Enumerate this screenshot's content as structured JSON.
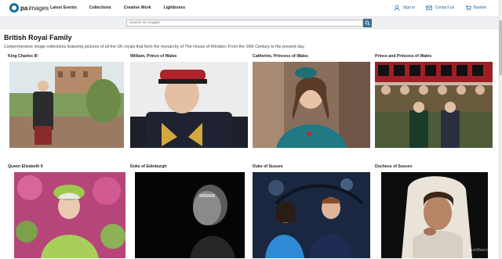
{
  "header": {
    "logo_pa": "pa",
    "logo_images": "images",
    "nav": [
      "Latest Events",
      "Collections",
      "Creative Work",
      "Lightboxes"
    ],
    "sign_in": "Sign in",
    "contact": "Contact us",
    "basket": "Basket"
  },
  "search": {
    "placeholder": "Search for images"
  },
  "page": {
    "title": "British Royal Family",
    "description": "Comprehensive image collections featuring pictures of all the UK royals that form the monarchy of The House of Windsor. From the 19th Century to the present day."
  },
  "collections": [
    {
      "title": "King Charles III"
    },
    {
      "title": "William, Prince of Wales"
    },
    {
      "title": "Catherine, Princess of Wales"
    },
    {
      "title": "Prince and Princess of Wales"
    },
    {
      "title": "Queen Elizabeth II"
    },
    {
      "title": "Duke of Edinburgh"
    },
    {
      "title": "Duke of Sussex"
    },
    {
      "title": "Duchess of Sussex"
    }
  ],
  "watermark": "PeakMaterials",
  "colors": {
    "accent": "#2468a0",
    "search_button": "#3a6f8f",
    "band": "#eef0f2"
  }
}
